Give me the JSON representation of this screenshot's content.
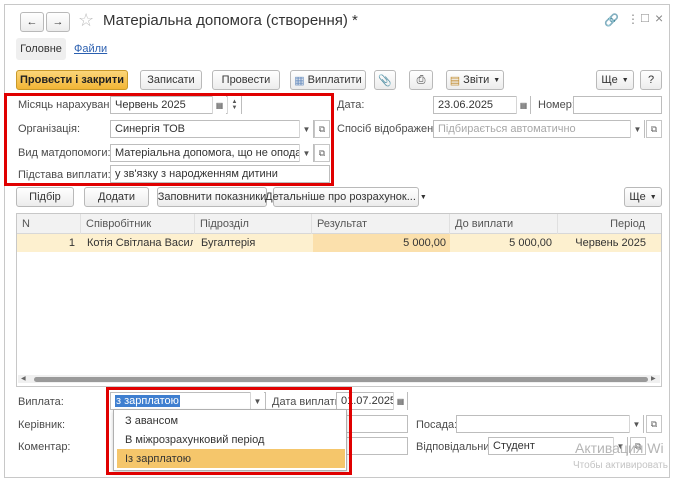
{
  "window": {
    "title": "Матеріальна допомога (створення) *"
  },
  "nav_tabs": [
    {
      "label": "Головне"
    },
    {
      "label": "Файли"
    }
  ],
  "toolbar": {
    "post_close": "Провести і закрити",
    "save": "Записати",
    "post": "Провести",
    "pay": "Виплатити",
    "reports": "Звіти",
    "more": "Ще",
    "help": "?"
  },
  "form": {
    "month_label": "Місяць нарахування:",
    "month_value": "Червень 2025",
    "org_label": "Організація:",
    "org_value": "Синергія ТОВ",
    "aid_type_label": "Вид матдопомоги:",
    "aid_type_value": "Матеріальна допомога, що не оподатковується",
    "basis_label": "Підстава виплати:",
    "basis_value": "у зв'язку з народженням дитини",
    "date_label": "Дата:",
    "date_value": "23.06.2025",
    "number_label": "Номер:",
    "number_value": "",
    "display_label": "Спосіб відображення:",
    "display_placeholder": "Підбирається автоматично"
  },
  "table_toolbar": {
    "select": "Підбір",
    "add": "Додати",
    "fill": "Заповнити показники",
    "details": "Детальніше про розрахунок...",
    "more": "Ще"
  },
  "table": {
    "columns": [
      "N",
      "Співробітник",
      "Підрозділ",
      "Результат",
      "До виплати",
      "Період"
    ],
    "rows": [
      {
        "n": "1",
        "employee": "Котія Світлана Василі...",
        "dept": "Бугалтерія",
        "result": "5 000,00",
        "payout": "5 000,00",
        "period": "Червень 2025"
      }
    ]
  },
  "footer": {
    "payment_label": "Виплата:",
    "payment_value": "з зарплатою",
    "pay_date_label": "Дата виплати:",
    "pay_date_value": "01.07.2025",
    "manager_label": "Керівник:",
    "position_label": "Посада:",
    "comment_label": "Коментар:",
    "responsible_label": "Відповідальний:",
    "responsible_value": "Студент"
  },
  "dropdown": {
    "options": [
      "З авансом",
      "В міжрозрахунковий період",
      "Із зарплатою"
    ],
    "selected_index": 2
  },
  "watermark": {
    "line1": "Активация Wi",
    "line2": "Чтобы активировать"
  },
  "colors": {
    "accent": "#f2b535",
    "highlight_row": "#fdf0cf",
    "result_cell": "#fbe0ac",
    "selection": "#f5c66b",
    "red_annotation": "#e00000",
    "link": "#2a5fb0"
  }
}
